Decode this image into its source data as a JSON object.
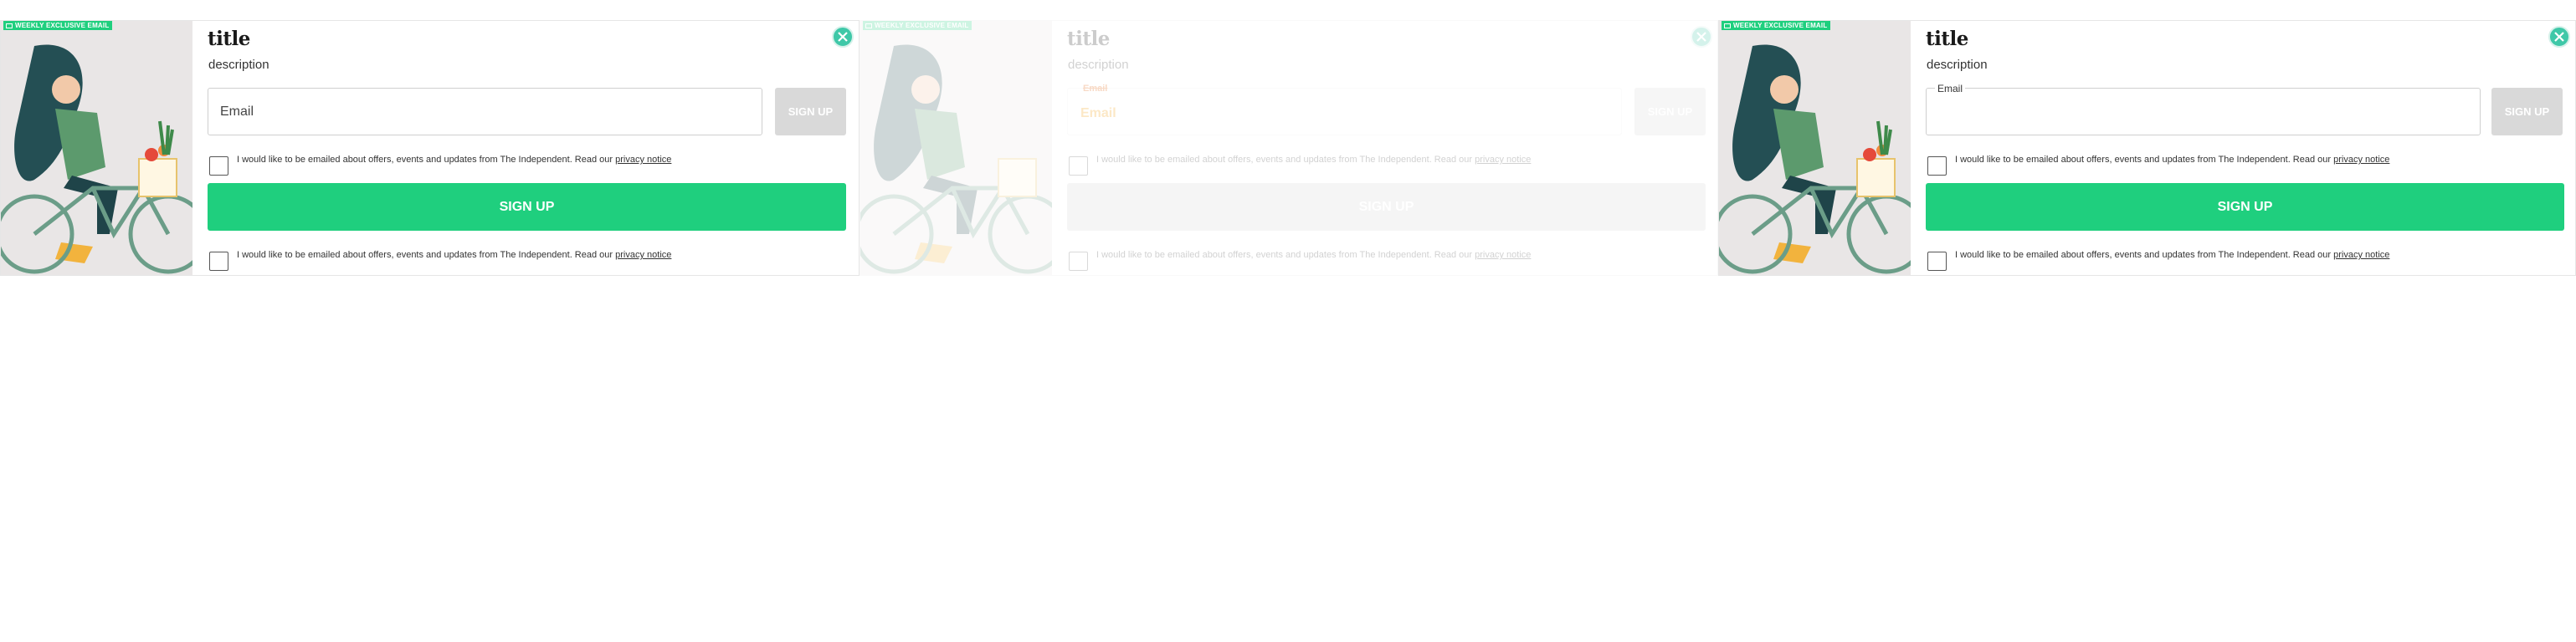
{
  "badge": "WEEKLY EXCLUSIVE EMAIL",
  "title": "title",
  "description": "description",
  "email": {
    "placeholder": "Email",
    "floating_label": "Email",
    "error_label": "Email"
  },
  "small_button_label": "SIGN UP",
  "big_button_label": "SIGN UP",
  "consent": {
    "text": "I would like to be emailed about offers, events and updates from The Independent. Read our ",
    "link": "privacy notice"
  },
  "colors": {
    "accent": "#1fcf7e",
    "close": "#3fc8a8",
    "disabled": "#d9d9d9"
  },
  "icons": [
    "mail-icon",
    "close-icon",
    "cyclist-illustration"
  ]
}
